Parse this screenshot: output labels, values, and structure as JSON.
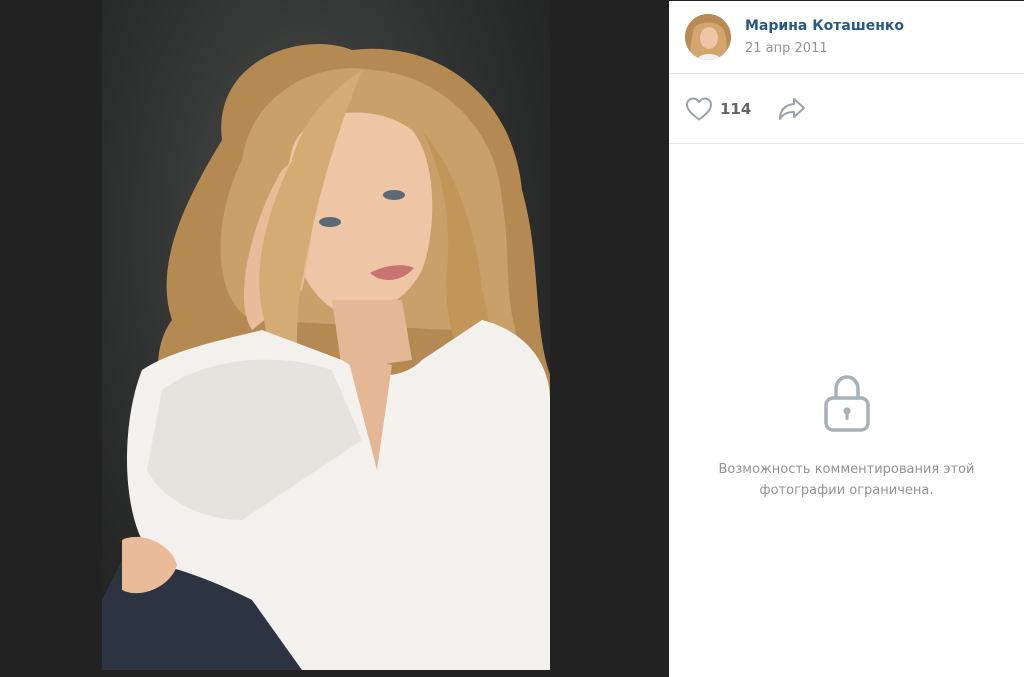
{
  "post": {
    "author_name": "Марина Коташенко",
    "date": "21 апр 2011"
  },
  "actions": {
    "like_count": "114",
    "like_icon": "heart-icon",
    "share_icon": "share-arrow-icon"
  },
  "comments": {
    "lock_icon": "lock-icon",
    "restricted_text": "Возможность комментирования этой фотографии ограничена."
  },
  "colors": {
    "accent": "#2a5885",
    "muted": "#939393",
    "icon": "#99a2ad",
    "backdrop": "#222222"
  }
}
